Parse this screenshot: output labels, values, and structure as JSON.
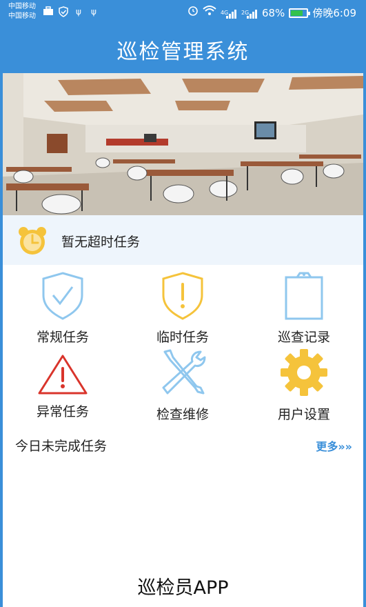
{
  "status_bar": {
    "carrier_1": "中国移动",
    "carrier_2": "中国移动",
    "net_1": "4G",
    "net_2": "2G",
    "battery": "68%",
    "battery_level": 0.68,
    "time": "傍晚6:09"
  },
  "header": {
    "title": "巡检管理系统"
  },
  "notice": {
    "text": "暂无超时任务",
    "icon": "alarm-clock-icon"
  },
  "menu": [
    {
      "label": "常规任务",
      "icon": "shield-check-icon"
    },
    {
      "label": "临时任务",
      "icon": "shield-alert-icon"
    },
    {
      "label": "巡查记录",
      "icon": "clipboard-icon"
    },
    {
      "label": "异常任务",
      "icon": "warning-triangle-icon"
    },
    {
      "label": "检查维修",
      "icon": "tools-icon"
    },
    {
      "label": "用户设置",
      "icon": "gear-icon"
    }
  ],
  "today": {
    "title": "今日未完成任务",
    "more": "更多",
    "more_icon": "double-chevron-right-icon"
  },
  "footer": {
    "app_name": "巡检员APP"
  },
  "colors": {
    "primary": "#3a8fd9",
    "yellow": "#f5c33b",
    "red": "#d9342b",
    "light_blue": "#8fc7ee",
    "notice_bg": "#eef5fc"
  }
}
